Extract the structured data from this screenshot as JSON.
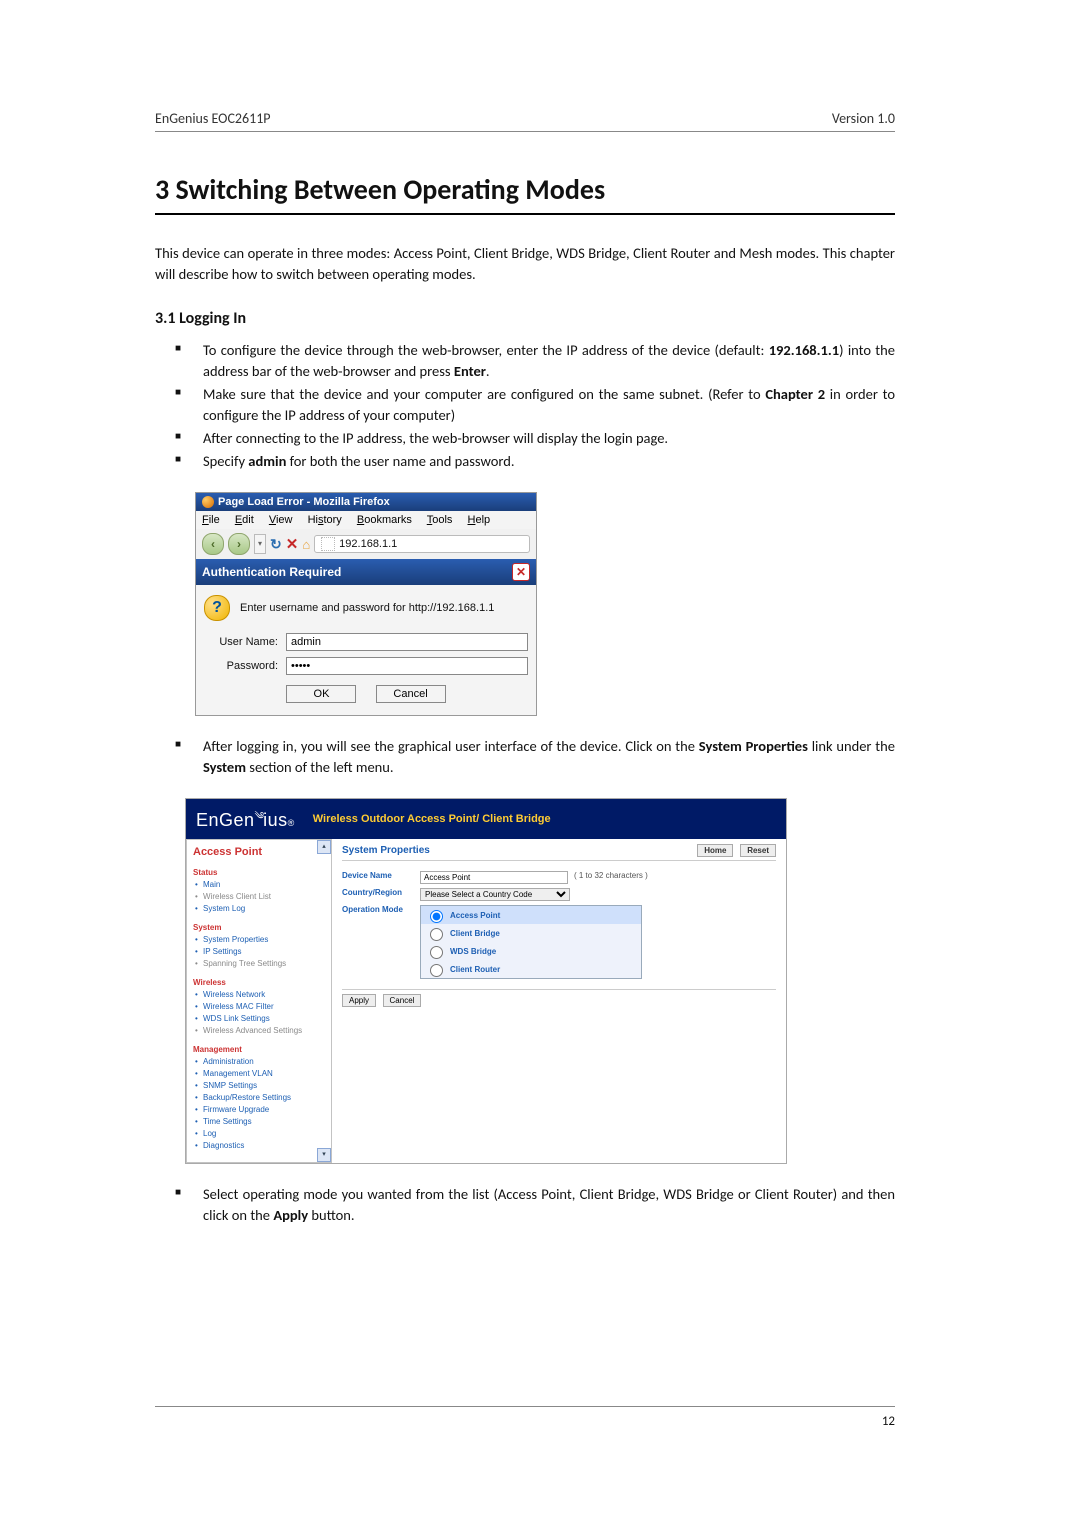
{
  "header": {
    "left": "EnGenius   EOC2611P",
    "right": "Version 1.0"
  },
  "title": "3   Switching Between Operating Modes",
  "intro": "This device can operate in three modes: Access Point, Client Bridge, WDS Bridge, Client Router and Mesh modes. This chapter will describe how to switch between operating modes.",
  "section_3_1": "3.1 Logging In",
  "bul1": {
    "i1a": "To configure the device through the web-browser, enter the IP address of the device (default: ",
    "i1b": "192.168.1.1",
    "i1c": ") into the address bar of the web-browser and press ",
    "i1d": "Enter",
    "i1e": ".",
    "i2a": "Make sure that the device and your computer are configured on the same subnet. (Refer to ",
    "i2b": "Chapter 2",
    "i2c": " in order to configure the IP address of your computer)",
    "i3": "After connecting to the IP address, the web-browser will display the login page.",
    "i4a": "Specify ",
    "i4b": "admin",
    "i4c": " for both the user name and password."
  },
  "firefox": {
    "title": "Page Load Error - Mozilla Firefox",
    "menu": {
      "file": "File",
      "edit": "Edit",
      "view": "View",
      "history": "History",
      "bookmarks": "Bookmarks",
      "tools": "Tools",
      "help": "Help"
    },
    "address": "192.168.1.1",
    "auth_title": "Authentication Required",
    "auth_msg": "Enter username and password for http://192.168.1.1",
    "user_label": "User Name:",
    "user_val": "admin",
    "pass_label": "Password:",
    "pass_val": "•••••",
    "ok": "OK",
    "cancel": "Cancel"
  },
  "bul2": {
    "i1a": "After logging in, you will see the graphical user interface of the device. Click on the ",
    "i1b": "System Properties",
    "i1c": " link under the ",
    "i1d": "System",
    "i1e": " section of the left menu."
  },
  "eg": {
    "brand": "EnGenius",
    "header": "Wireless Outdoor Access Point/ Client Bridge",
    "mode_title": "Access Point",
    "sections": {
      "status": "Status",
      "system": "System",
      "wireless": "Wireless",
      "management": "Management"
    },
    "items": {
      "status": [
        "Main",
        "Wireless Client List",
        "System Log"
      ],
      "system": [
        "System Properties",
        "IP Settings",
        "Spanning Tree Settings"
      ],
      "wireless": [
        "Wireless Network",
        "Wireless MAC Filter",
        "WDS Link Settings",
        "Wireless Advanced Settings"
      ],
      "management": [
        "Administration",
        "Management VLAN",
        "SNMP Settings",
        "Backup/Restore Settings",
        "Firmware Upgrade",
        "Time Settings",
        "Log",
        "Diagnostics"
      ]
    },
    "panel_title": "System Properties",
    "home": "Home",
    "reset": "Reset",
    "device_name_lbl": "Device Name",
    "device_name_val": "Access Point",
    "device_name_hint": "( 1 to 32 characters )",
    "country_lbl": "Country/Region",
    "country_val": "Please Select a Country Code",
    "opmode_lbl": "Operation Mode",
    "ops": [
      "Access Point",
      "Client Bridge",
      "WDS Bridge",
      "Client Router"
    ],
    "apply": "Apply",
    "cancel": "Cancel"
  },
  "bul3": {
    "i1a": "Select operating mode you wanted from the list (Access Point, Client Bridge, WDS Bridge or Client Router) and then click on the ",
    "i1b": "Apply",
    "i1c": " button."
  },
  "page_number": "12"
}
